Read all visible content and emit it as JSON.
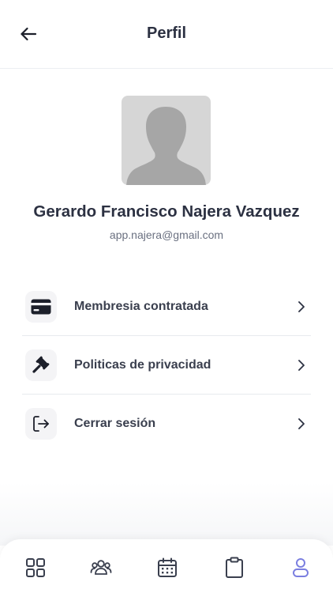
{
  "header": {
    "title": "Perfil",
    "back_icon": "arrow-left-icon"
  },
  "profile": {
    "name": "Gerardo Francisco Najera Vazquez",
    "email": "app.najera@gmail.com",
    "avatar_icon": "person-silhouette-icon"
  },
  "menu": {
    "items": [
      {
        "label": "Membresia contratada",
        "icon": "credit-card-icon"
      },
      {
        "label": "Politicas de privacidad",
        "icon": "gavel-icon"
      },
      {
        "label": "Cerrar sesión",
        "icon": "logout-icon"
      }
    ]
  },
  "bottom_nav": {
    "items": [
      {
        "icon": "grid-icon",
        "active": false
      },
      {
        "icon": "users-icon",
        "active": false
      },
      {
        "icon": "calendar-icon",
        "active": false
      },
      {
        "icon": "clipboard-icon",
        "active": false
      },
      {
        "icon": "profile-icon",
        "active": true
      }
    ]
  },
  "colors": {
    "text_dark": "#2c3142",
    "text_muted": "#6a7080",
    "icon_inactive": "#3a3f4e",
    "icon_active": "#7b7fe0",
    "avatar_bg": "#d6d6d6",
    "avatar_figure": "#a6a6a6",
    "divider": "#e8eaee"
  }
}
